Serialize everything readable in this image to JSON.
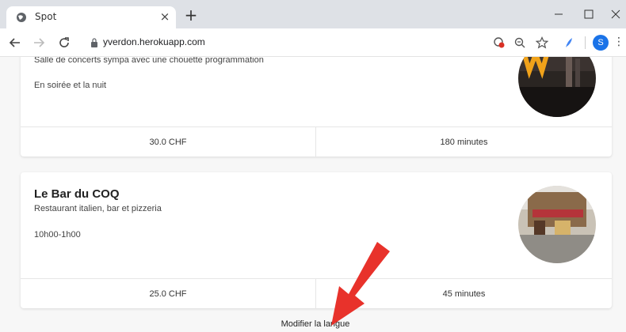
{
  "browser": {
    "tab_title": "Spot",
    "tab_close": "×",
    "new_tab": "+",
    "window_min": "–",
    "window_max": "☐",
    "window_close": "✕",
    "url": "yverdon.herokuapp.com",
    "profile_initial": "S",
    "menu": "⋮"
  },
  "cards": [
    {
      "title": "",
      "description": "Salle de concerts sympa avec une chouette programmation",
      "hours": "En soirée et la nuit",
      "price": "30.0 CHF",
      "duration": "180 minutes"
    },
    {
      "title": "Le Bar du COQ",
      "description": "Restaurant italien, bar et pizzeria",
      "hours": "10h00-1h00",
      "price": "25.0 CHF",
      "duration": "45 minutes"
    }
  ],
  "footer": {
    "change_language": "Modifier la langue"
  },
  "colors": {
    "arrow": "#e8322b",
    "accent": "#1a73e8"
  }
}
